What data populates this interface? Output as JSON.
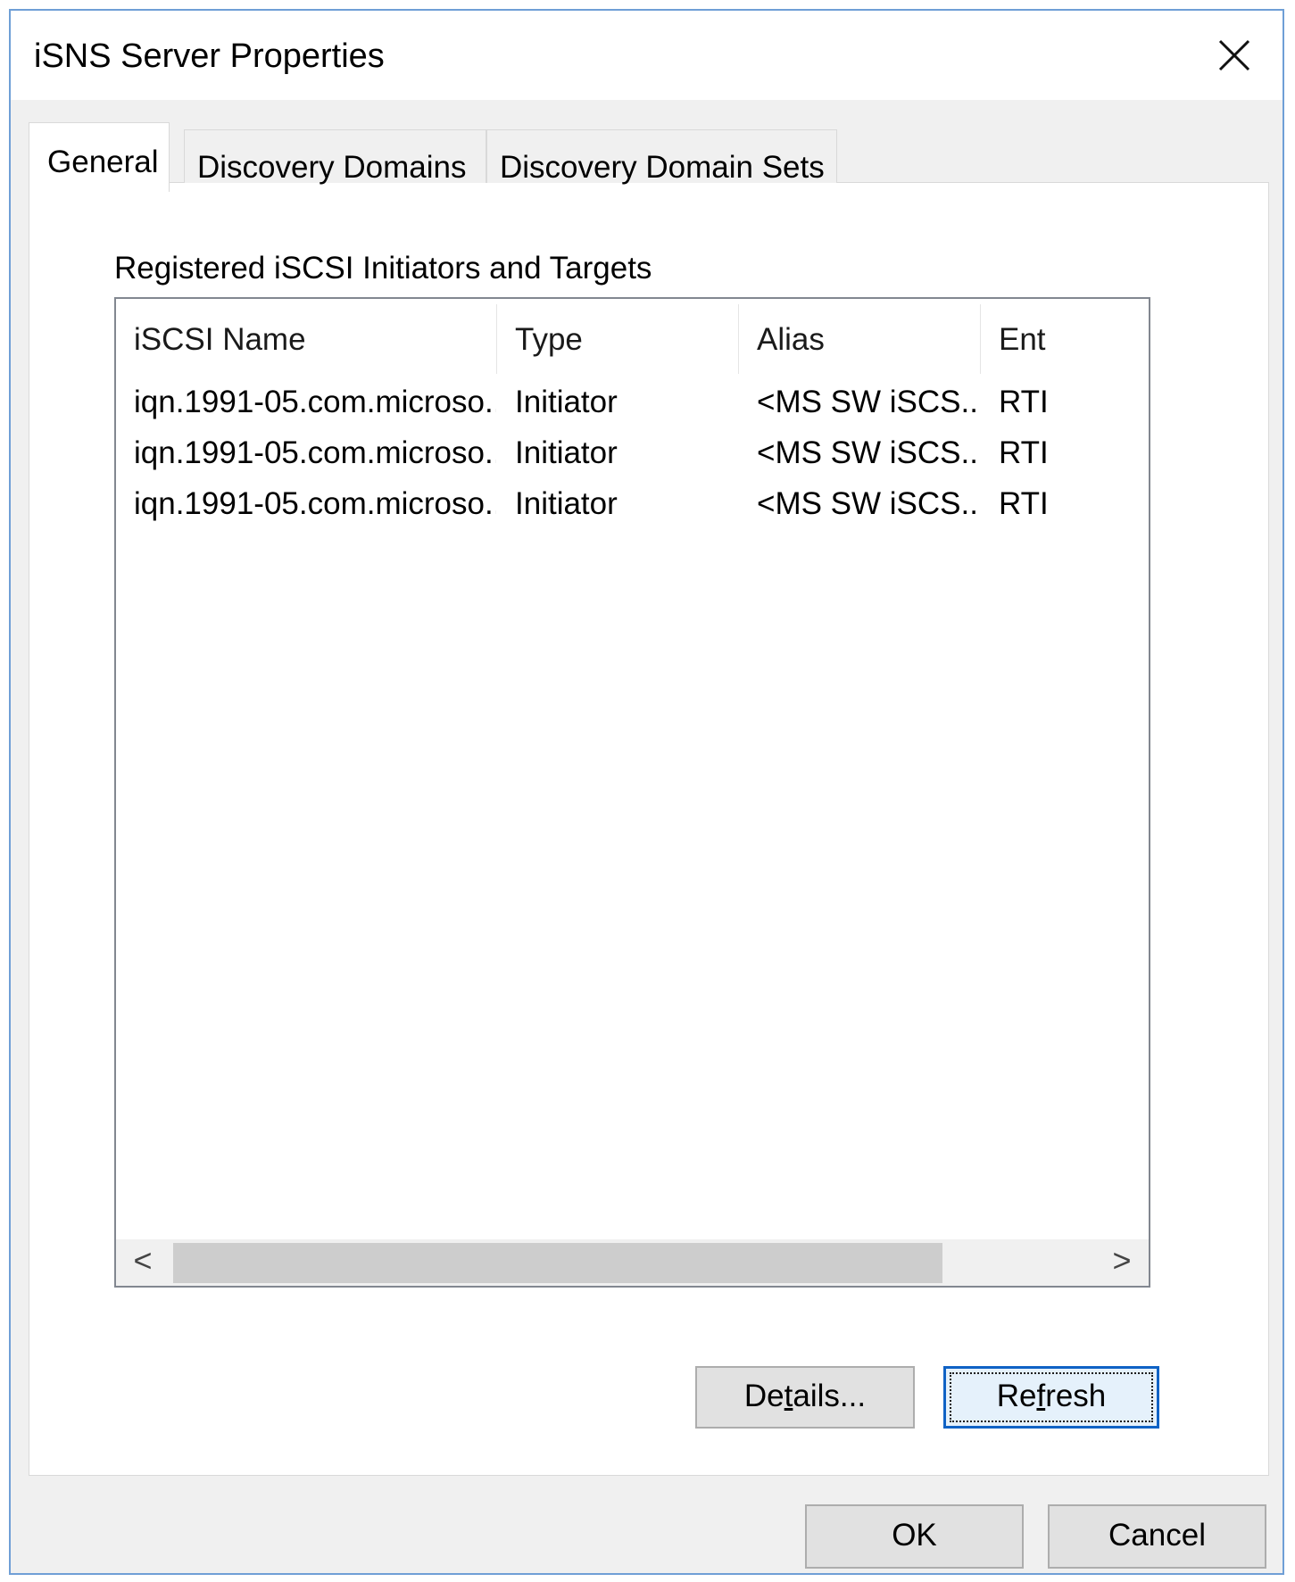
{
  "window": {
    "title": "iSNS Server Properties",
    "close_icon": "close-icon"
  },
  "tabs": [
    {
      "label": "General",
      "active": true
    },
    {
      "label": "Discovery Domains",
      "active": false
    },
    {
      "label": "Discovery Domain Sets",
      "active": false
    }
  ],
  "general": {
    "group_label": "Registered iSCSI Initiators and Targets",
    "columns": [
      "iSCSI Name",
      "Type",
      "Alias",
      "Ent"
    ],
    "rows": [
      {
        "name": "iqn.1991-05.com.microso...",
        "type": "Initiator",
        "alias": "<MS SW iSCS...",
        "entity": "RTI"
      },
      {
        "name": "iqn.1991-05.com.microso...",
        "type": "Initiator",
        "alias": "<MS SW iSCS...",
        "entity": "RTI"
      },
      {
        "name": "iqn.1991-05.com.microso...",
        "type": "Initiator",
        "alias": "<MS SW iSCS...",
        "entity": "RTI"
      }
    ],
    "scroll": {
      "left_icon": "chevron-left-icon",
      "right_icon": "chevron-right-icon",
      "left_glyph": "<",
      "right_glyph": ">"
    },
    "details_button": {
      "before": "De",
      "mnemonic": "t",
      "after": "ails..."
    },
    "refresh_button": {
      "before": "Re",
      "mnemonic": "f",
      "after": "resh"
    }
  },
  "footer": {
    "ok_label": "OK",
    "cancel_label": "Cancel"
  }
}
